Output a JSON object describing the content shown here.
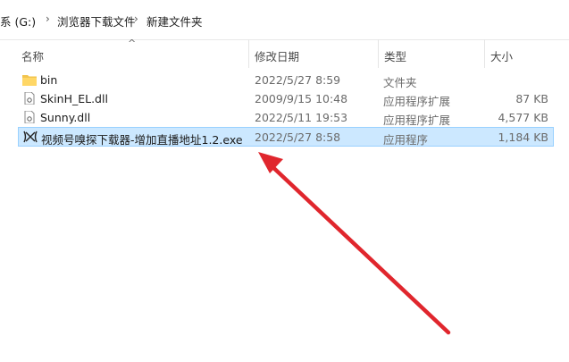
{
  "breadcrumb": {
    "drive": "系 (G:)",
    "folder1": "浏览器下载文件",
    "folder2": "新建文件夹",
    "separator": "›"
  },
  "columns": {
    "name": "名称",
    "date": "修改日期",
    "type": "类型",
    "size": "大小"
  },
  "sort_indicator": "^",
  "files": [
    {
      "name": "bin",
      "date": "2022/5/27 8:59",
      "type": "文件夹",
      "size": "",
      "icon": "folder-icon"
    },
    {
      "name": "SkinH_EL.dll",
      "date": "2009/9/15 10:48",
      "type": "应用程序扩展",
      "size": "87 KB",
      "icon": "dll-file-icon"
    },
    {
      "name": "Sunny.dll",
      "date": "2022/5/11 19:53",
      "type": "应用程序扩展",
      "size": "4,577 KB",
      "icon": "dll-file-icon"
    },
    {
      "name": "视频号嗅探下载器-增加直播地址1.2.exe",
      "date": "2022/5/27 8:58",
      "type": "应用程序",
      "size": "1,184 KB",
      "icon": "exe-app-icon"
    }
  ],
  "selected_index": 3,
  "annotation": {
    "color": "#e0262d",
    "icon": "red-arrow-annotation"
  },
  "colors": {
    "selection_bg": "#cce8ff",
    "selection_border": "#99d1ff",
    "folder": "#f2c44e"
  }
}
